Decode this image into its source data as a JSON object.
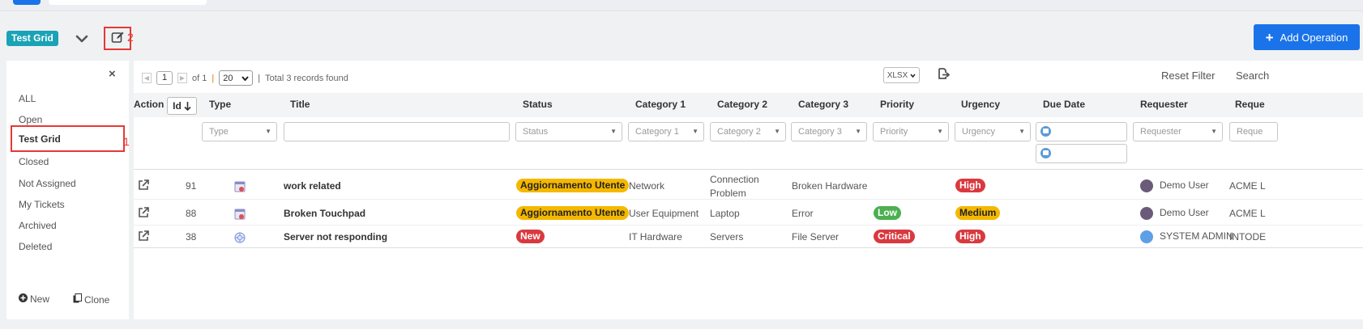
{
  "header": {
    "grid_badge": "Test Grid",
    "annotation_2": "2",
    "add_operation": "Add Operation"
  },
  "sidebar": {
    "close": "×",
    "items": [
      "ALL",
      "Open",
      "Test Grid",
      "Closed",
      "Not Assigned",
      "My Tickets",
      "Archived",
      "Deleted"
    ],
    "annotation_1": "1",
    "new_label": "New",
    "clone_label": "Clone"
  },
  "toolbar": {
    "page_value": "1",
    "of_label": "of 1",
    "sep": "|",
    "page_size": "20",
    "total": "Total 3 records found",
    "export_format": "XLSX",
    "reset_filter": "Reset Filter",
    "search": "Search"
  },
  "columns": {
    "action": "Action",
    "id": "Id",
    "type": "Type",
    "title": "Title",
    "status": "Status",
    "category1": "Category 1",
    "category2": "Category 2",
    "category3": "Category 3",
    "priority": "Priority",
    "urgency": "Urgency",
    "due_date": "Due Date",
    "requester": "Requester",
    "reque": "Reque"
  },
  "filters": {
    "type": "Type",
    "status": "Status",
    "category1": "Category 1",
    "category2": "Category 2",
    "category3": "Category 3",
    "priority": "Priority",
    "urgency": "Urgency",
    "requester": "Requester",
    "reque": "Reque"
  },
  "rows": [
    {
      "id": "91",
      "title": "work related",
      "status": "Aggiornamento Utente",
      "category1": "Network",
      "category2a": "Connection",
      "category2b": "Problem",
      "category3": "Broken Hardware",
      "priority": "",
      "urgency": "High",
      "requester": "Demo User",
      "company": "ACME L"
    },
    {
      "id": "88",
      "title": "Broken Touchpad",
      "status": "Aggiornamento Utente",
      "category1": "User Equipment",
      "category2a": "Laptop",
      "category2b": "",
      "category3": "Error",
      "priority": "Low",
      "urgency": "Medium",
      "requester": "Demo User",
      "company": "ACME L"
    },
    {
      "id": "38",
      "title": "Server not responding",
      "status": "New",
      "category1": "IT Hardware",
      "category2a": "Servers",
      "category2b": "",
      "category3": "File Server",
      "priority": "Critical",
      "urgency": "High",
      "requester": "SYSTEM ADMIN",
      "company": "INTODE"
    }
  ],
  "colors": {
    "primary": "#1a73e8",
    "grid_badge": "#1aa3b7",
    "annotation": "#e53935",
    "pill_yellow": "#f5b800",
    "pill_red": "#d9393f",
    "pill_green": "#4caf50"
  }
}
